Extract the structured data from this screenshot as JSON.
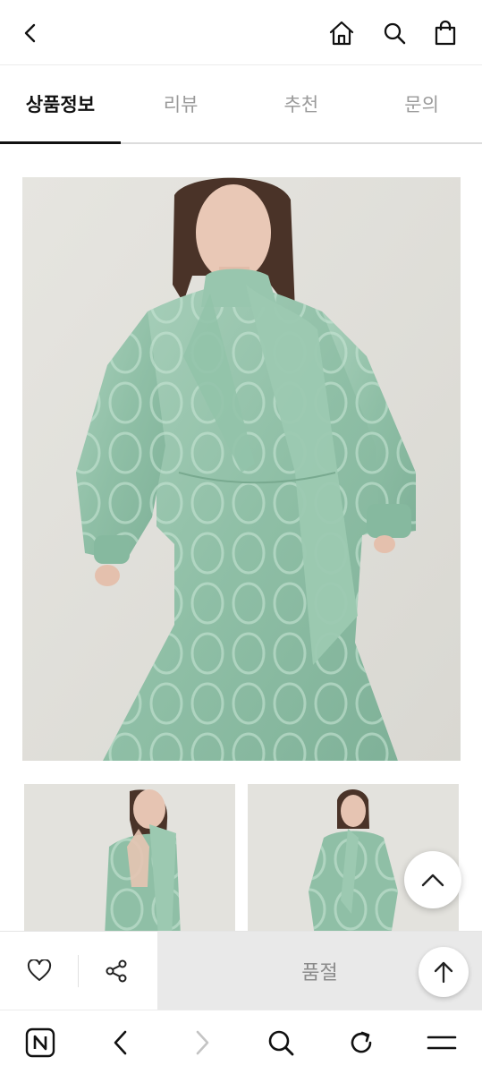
{
  "header": {
    "icons": [
      "chevron-left-icon",
      "home-icon",
      "search-icon",
      "shopping-bag-icon"
    ]
  },
  "tabs": [
    {
      "label": "상품정보",
      "active": true
    },
    {
      "label": "리뷰",
      "active": false
    },
    {
      "label": "추천",
      "active": false
    },
    {
      "label": "문의",
      "active": false
    }
  ],
  "product": {
    "images": [
      "main-photo",
      "thumbnail-back-view",
      "thumbnail-full-view"
    ],
    "dress_color": "#8fbfa6"
  },
  "buy_bar": {
    "soldout_label": "품절",
    "icons": [
      "heart-icon",
      "share-icon",
      "arrow-up-icon"
    ]
  },
  "browser_nav": {
    "icons": [
      "naver-n-icon",
      "back-icon",
      "forward-icon",
      "search-icon",
      "refresh-icon",
      "menu-icon"
    ]
  }
}
